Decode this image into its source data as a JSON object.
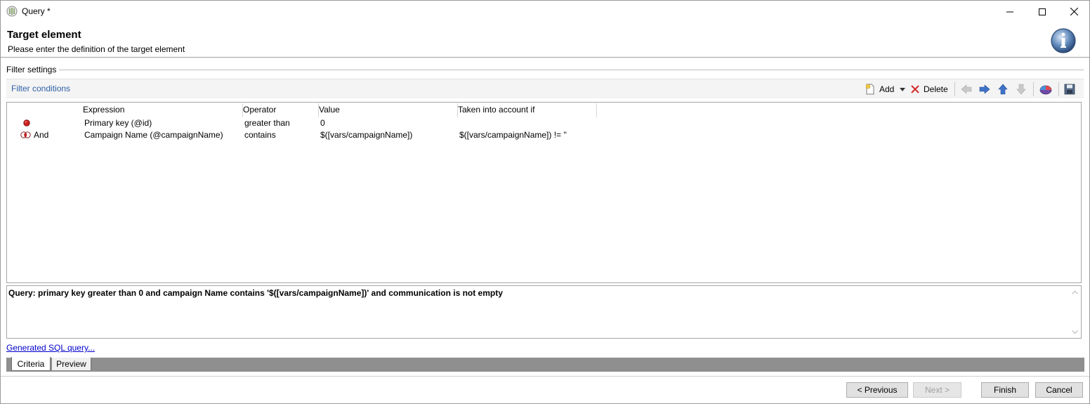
{
  "window": {
    "title": "Query *",
    "controls": {
      "minimize": "minimize-icon",
      "maximize": "maximize-icon",
      "close": "close-icon"
    }
  },
  "header": {
    "title": "Target element",
    "subtitle": "Please enter the definition of the target element",
    "icon": "info-icon"
  },
  "filter_settings": {
    "group_label": "Filter settings",
    "conditions_label": "Filter conditions",
    "toolbar": {
      "add_label": "Add",
      "delete_label": "Delete"
    }
  },
  "conditions": {
    "columns": [
      "Expression",
      "Operator",
      "Value",
      "Taken into account if"
    ],
    "rows": [
      {
        "logic": "",
        "expression": "Primary key (@id)",
        "operator": "greater than",
        "value": "0",
        "taken_into_account_if": ""
      },
      {
        "logic": "And",
        "expression": "Campaign Name (@campaignName)",
        "operator": "contains",
        "value": "$([vars/campaignName])",
        "taken_into_account_if": "$([vars/campaignName]) != ''"
      }
    ]
  },
  "query_text": "Query: primary key greater than 0 and campaign Name contains '$([vars/campaignName])' and communication is not empty",
  "sql_link": "Generated SQL query...",
  "tabs": [
    "Criteria",
    "Preview"
  ],
  "buttons": {
    "previous": "< Previous",
    "next": "Next >",
    "finish": "Finish",
    "cancel": "Cancel"
  },
  "colors": {
    "link_blue": "#0000cc",
    "section_blue": "#2f5fa8",
    "condition_red": "#cc1f1f",
    "tab_strip": "#8f8f8f"
  }
}
